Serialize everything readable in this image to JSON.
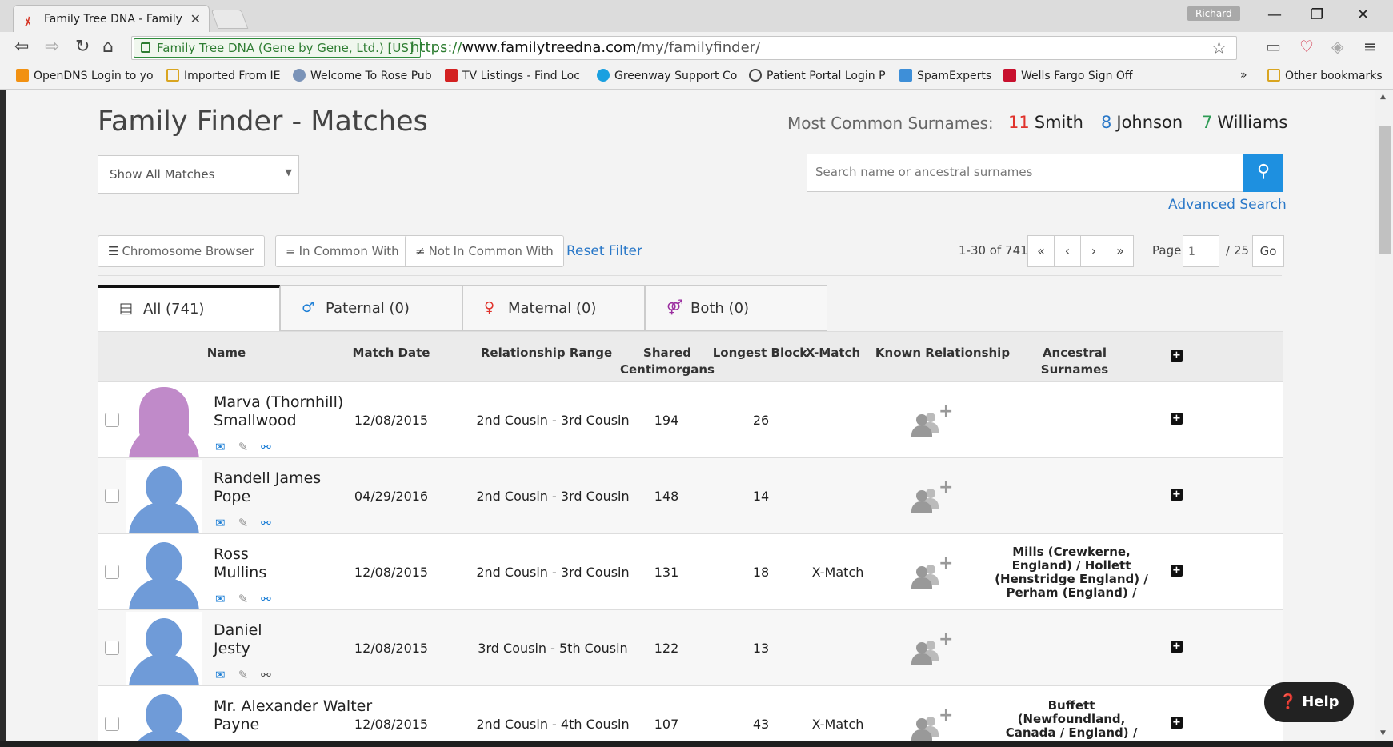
{
  "browser": {
    "tab_title": "Family Tree DNA - Family",
    "user_name": "Richard",
    "site_identity": "Family Tree DNA (Gene by Gene, Ltd.) [US]",
    "url_scheme": "https://",
    "url_host": "www.familytreedna.com",
    "url_path": "/my/familyfinder/",
    "bookmarks": [
      "OpenDNS Login to yo",
      "Imported From IE",
      "Welcome To Rose Pub",
      "TV Listings - Find Loc",
      "Greenway Support Co",
      "Patient Portal Login P",
      "SpamExperts",
      "Wells Fargo Sign Off"
    ],
    "bookmarks_overflow": "»",
    "other_bookmarks": "Other bookmarks"
  },
  "header": {
    "title": "Family Finder - Matches",
    "surnames_label": "Most Common Surnames:",
    "surnames": [
      {
        "count": "11",
        "name": "Smith",
        "color": "#e0322b"
      },
      {
        "count": "8",
        "name": "Johnson",
        "color": "#2a78c8"
      },
      {
        "count": "7",
        "name": "Williams",
        "color": "#2e9b55"
      }
    ]
  },
  "filters": {
    "show_select": "Show All Matches",
    "search_placeholder": "Search name or ancestral surnames",
    "advanced_search": "Advanced Search",
    "chromosome_browser": "Chromosome Browser",
    "in_common_with": "In Common With",
    "not_in_common_with": "Not In Common With",
    "reset_filter": "Reset Filter"
  },
  "pagination": {
    "range_text": "1-30 of 741",
    "first": "«",
    "prev": "‹",
    "next": "›",
    "last": "»",
    "page_label": "Page",
    "page_value": "1",
    "page_total": "/ 25",
    "go": "Go"
  },
  "tabs": [
    {
      "label": "All (741)",
      "icon": "list-icon",
      "active": true
    },
    {
      "label": "Paternal (0)",
      "icon": "male-icon",
      "active": false
    },
    {
      "label": "Maternal (0)",
      "icon": "female-icon",
      "active": false
    },
    {
      "label": "Both (0)",
      "icon": "couple-icon",
      "active": false
    }
  ],
  "table": {
    "headers": {
      "name": "Name",
      "match_date": "Match Date",
      "relationship_range": "Relationship Range",
      "shared_cm_1": "Shared",
      "shared_cm_2": "Centimorgans",
      "longest_block": "Longest Block",
      "x_match": "X-Match",
      "known_relationship": "Known Relationship",
      "ancestral_surnames": "Ancestral Surnames"
    },
    "rows": [
      {
        "name_1": "Marva (Thornhill)",
        "name_2": "Smallwood",
        "gender": "female",
        "match_date": "12/08/2015",
        "relationship": "2nd Cousin - 3rd Cousin",
        "shared_cm": "194",
        "longest_block": "26",
        "x_match": "",
        "ancestral": ""
      },
      {
        "name_1": "Randell James",
        "name_2": "Pope",
        "gender": "male",
        "match_date": "04/29/2016",
        "relationship": "2nd Cousin - 3rd Cousin",
        "shared_cm": "148",
        "longest_block": "14",
        "x_match": "",
        "ancestral": ""
      },
      {
        "name_1": "Ross",
        "name_2": "Mullins",
        "gender": "male",
        "match_date": "12/08/2015",
        "relationship": "2nd Cousin - 3rd Cousin",
        "shared_cm": "131",
        "longest_block": "18",
        "x_match": "X-Match",
        "ancestral": "Mills (Crewkerne, England) / Hollett (Henstridge England) / Perham (England) /"
      },
      {
        "name_1": "Daniel",
        "name_2": "Jesty",
        "gender": "male",
        "match_date": "12/08/2015",
        "relationship": "3rd Cousin - 5th Cousin",
        "shared_cm": "122",
        "longest_block": "13",
        "x_match": "",
        "ancestral": ""
      },
      {
        "name_1": "Mr. Alexander Walter",
        "name_2": "Payne",
        "gender": "male",
        "match_date": "12/08/2015",
        "relationship": "2nd Cousin - 4th Cousin",
        "shared_cm": "107",
        "longest_block": "43",
        "x_match": "X-Match",
        "ancestral": "Buffett (Newfoundland, Canada / England) /"
      }
    ]
  },
  "help_label": "Help"
}
